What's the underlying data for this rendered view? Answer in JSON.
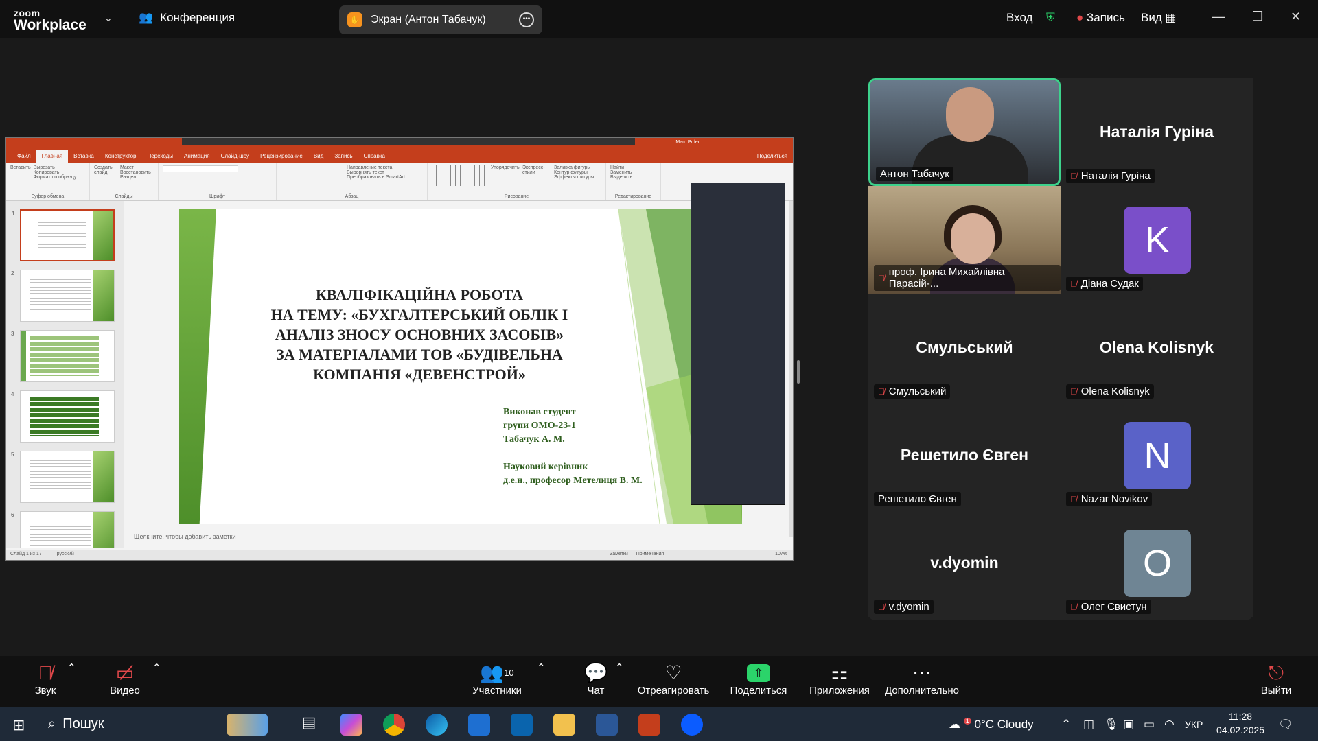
{
  "app": {
    "brand_top": "zoom",
    "brand_bottom": "Workplace",
    "meeting_label": "Конференция"
  },
  "share": {
    "label": "Экран (Антон Табачук)"
  },
  "top_right": {
    "signin": "Вход",
    "record": "Запись",
    "view": "Вид"
  },
  "colors": {
    "active_speaker": "#3dd28c",
    "record_dot": "#e0484a",
    "share_green": "#2bd46a",
    "ppt_red": "#c43e1c",
    "slide_green": "#4e8f2a"
  },
  "ppt": {
    "tabs": [
      "Файл",
      "Главная",
      "Вставка",
      "Конструктор",
      "Переходы",
      "Анимация",
      "Слайд-шоу",
      "Рецензирование",
      "Вид",
      "Запись",
      "Справка"
    ],
    "user": "Marc Prder",
    "share_btn": "Поделиться",
    "ribbon": {
      "paste": "Вставить",
      "cut": "Вырезать",
      "copy": "Копировать",
      "format": "Формат по образцу",
      "clipboard": "Буфер обмена",
      "new_slide": "Создать слайд",
      "layout": "Макет",
      "reset": "Восстановить",
      "section": "Раздел",
      "slides": "Слайды",
      "font": "Шрифт",
      "paragraph": "Абзац",
      "text_dir": "Направление текста",
      "align_text": "Выровнять текст",
      "smartart": "Преобразовать в SmartArt",
      "arrange": "Упорядочить",
      "quick_styles": "Экспресс-стили",
      "fill": "Заливка фигуры",
      "outline": "Контур фигуры",
      "effects": "Эффекты фигуры",
      "drawing": "Рисование",
      "find": "Найти",
      "replace": "Заменить",
      "select": "Выделить",
      "editing": "Редактирование"
    },
    "thumb_numbers": [
      "1",
      "2",
      "3",
      "4",
      "5",
      "6"
    ],
    "notes_placeholder": "Щелкните, чтобы добавить заметки",
    "status_left": "Слайд 1 из 17",
    "status_lang": "русский",
    "status_notes": "Заметки",
    "status_comments": "Примечания",
    "zoom": "107%"
  },
  "slide": {
    "title_lines": [
      "КВАЛІФІКАЦІЙНА РОБОТА",
      "НА ТЕМУ: «БУХГАЛТЕРСЬКИЙ ОБЛІК І",
      "АНАЛІЗ ЗНОСУ ОСНОВНИХ ЗАСОБІВ»",
      "ЗА МАТЕРІАЛАМИ ТОВ «БУДІВЕЛЬНА",
      "КОМПАНІЯ «ДЕВЕНСТРОЙ»"
    ],
    "author_lines": [
      "Виконав студент",
      "групи ОМО-23-1",
      "Табачук А. М.",
      "",
      "Науковий керівник",
      "д.е.н., професор Метелиця В. М."
    ]
  },
  "participants": [
    {
      "name": "Антон Табачук",
      "kind": "video1",
      "muted": false,
      "active": true
    },
    {
      "name": "Наталія Гуріна",
      "kind": "name",
      "muted": true
    },
    {
      "name": "проф. Ірина Михайлівна Парасій-...",
      "kind": "video2",
      "muted": true
    },
    {
      "name": "Діана Судак",
      "kind": "avatar",
      "letter": "K",
      "color": "#7a4fc9",
      "muted": true
    },
    {
      "name": "Смульський",
      "kind": "name",
      "muted": true
    },
    {
      "name": "Olena Kolisnyk",
      "kind": "name",
      "muted": true
    },
    {
      "name": "Решетило Євген",
      "kind": "name",
      "muted": false
    },
    {
      "name": "Nazar Novikov",
      "kind": "avatar",
      "letter": "N",
      "color": "#5a62c8",
      "muted": true
    },
    {
      "name": "v.dyomin",
      "kind": "name",
      "muted": true
    },
    {
      "name": "Олег Свистун",
      "kind": "avatar",
      "letter": "O",
      "color": "#6f8594",
      "muted": true
    }
  ],
  "toolbar": {
    "audio": "Звук",
    "video": "Видео",
    "participants": "Участники",
    "participants_count": "10",
    "chat": "Чат",
    "react": "Отреагировать",
    "share": "Поделиться",
    "apps": "Приложения",
    "more": "Дополнительно",
    "leave": "Выйти"
  },
  "taskbar": {
    "search": "Пошук",
    "weather": "0°C  Cloudy",
    "weather_badge": "1",
    "lang": "УКР",
    "time": "11:28",
    "date": "04.02.2025"
  }
}
